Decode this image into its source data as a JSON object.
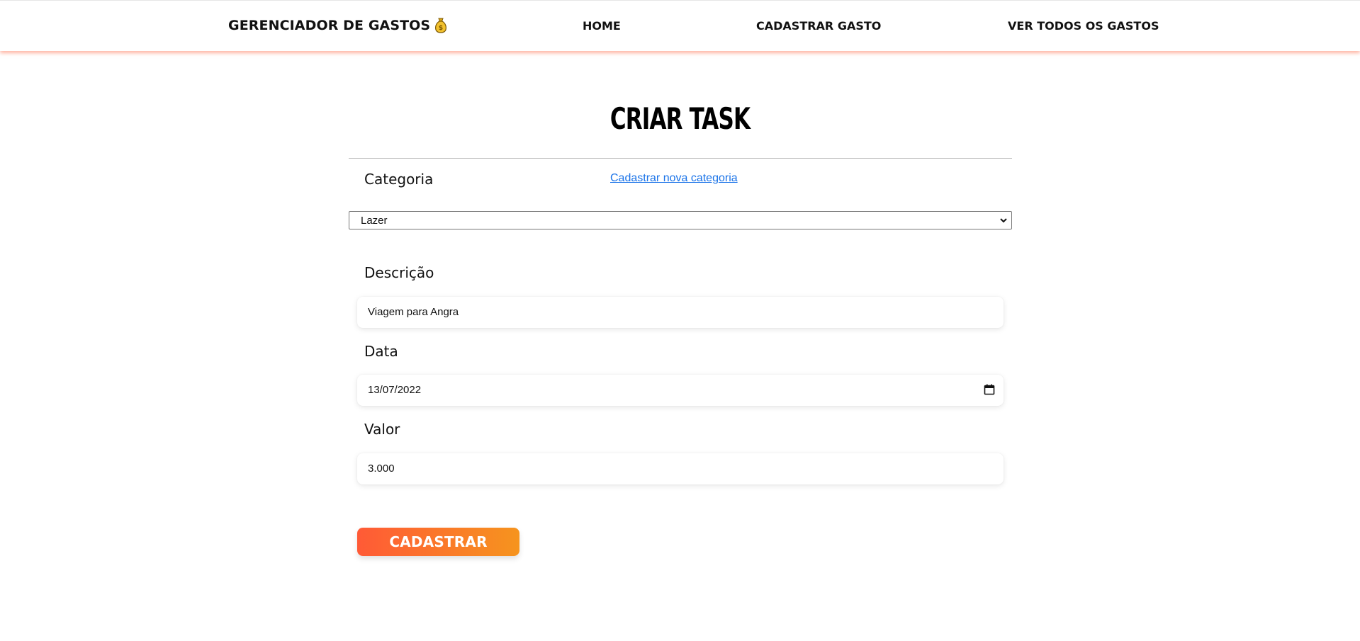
{
  "header": {
    "brand": "GERENCIADOR DE GASTOS",
    "nav": {
      "home": "HOME",
      "add_expense": "CADASTRAR GASTO",
      "all_expenses": "VER TODOS OS GASTOS"
    }
  },
  "form": {
    "title": "CRIAR TASK",
    "category_label": "Categoria",
    "new_category_link": "Cadastrar nova categoria",
    "category_selected": "Lazer",
    "description_label": "Descrição",
    "description_value": "Viagem para Angra",
    "date_label": "Data",
    "date_value": "13/07/2022",
    "value_label": "Valor",
    "value_value": "3.000",
    "submit_label": "CADASTRAR"
  },
  "icons": {
    "brand_icon": "money-bag-icon",
    "date_icon": "calendar-icon",
    "select_icon": "chevron-down-icon"
  },
  "colors": {
    "accent_start": "#ff5a36",
    "accent_end": "#f6941e",
    "link": "#1a73e8"
  }
}
